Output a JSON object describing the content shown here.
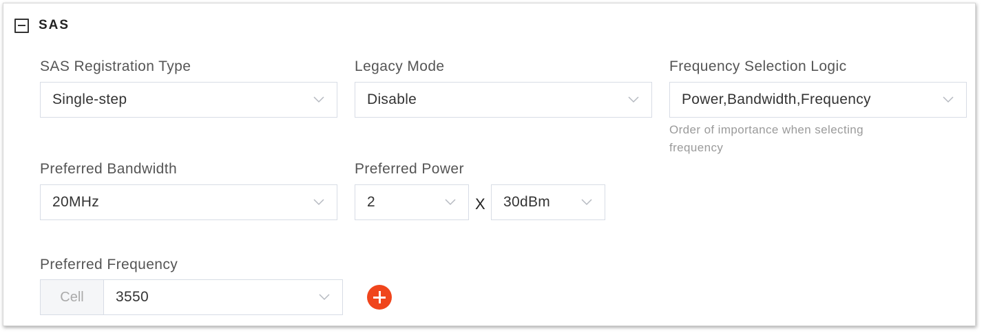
{
  "section": {
    "title": "SAS"
  },
  "fields": {
    "registration_type": {
      "label": "SAS Registration Type",
      "value": "Single-step"
    },
    "legacy_mode": {
      "label": "Legacy Mode",
      "value": "Disable"
    },
    "frequency_logic": {
      "label": "Frequency Selection Logic",
      "value": "Power,Bandwidth,Frequency",
      "hint_line1": "Order of importance when selecting",
      "hint_line2": "frequency"
    },
    "preferred_bandwidth": {
      "label": "Preferred Bandwidth",
      "value": "20MHz"
    },
    "preferred_power": {
      "label": "Preferred Power",
      "multiplier": "2",
      "times": "X",
      "value": "30dBm"
    },
    "preferred_frequency": {
      "label": "Preferred Frequency",
      "addon": "Cell",
      "value": "3550"
    }
  },
  "colors": {
    "add_button": "#f0451c",
    "border": "#d7dce5"
  }
}
